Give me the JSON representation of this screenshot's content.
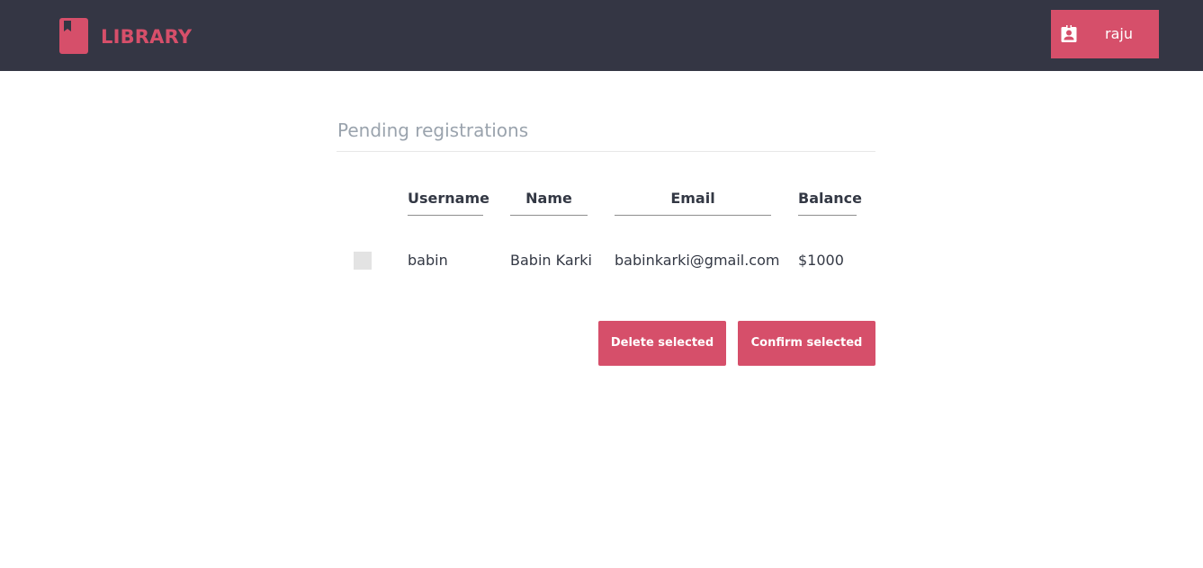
{
  "header": {
    "logo_text": "LIBRARY",
    "logo_icon": "bookmark-icon",
    "user_icon": "contact-badge-icon",
    "user_name": "raju",
    "background_color": "#343644",
    "accent_color": "#d64f6a"
  },
  "main": {
    "title": "Pending registrations",
    "table": {
      "columns": [
        "Username",
        "Name",
        "Email",
        "Balance"
      ],
      "rows": [
        {
          "selected": false,
          "username": "babin",
          "name": "Babin Karki",
          "email": "babinkarki@gmail.com",
          "balance": "$1000"
        }
      ]
    },
    "actions": {
      "delete_label": "Delete selected",
      "confirm_label": "Confirm selected"
    }
  }
}
